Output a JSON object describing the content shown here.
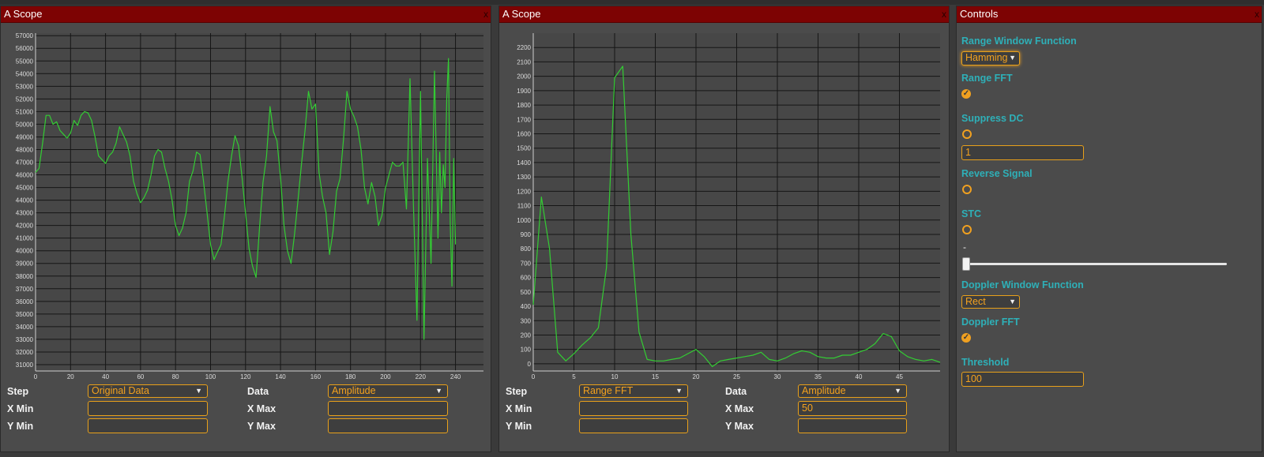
{
  "scope1": {
    "title": "A Scope",
    "close": "x",
    "form": {
      "step_label": "Step",
      "step_value": "Original Data",
      "data_label": "Data",
      "data_value": "Amplitude",
      "xmin_label": "X Min",
      "xmin_value": "",
      "xmax_label": "X Max",
      "xmax_value": "",
      "ymin_label": "Y Min",
      "ymin_value": "",
      "ymax_label": "Y Max",
      "ymax_value": ""
    }
  },
  "scope2": {
    "title": "A Scope",
    "close": "x",
    "form": {
      "step_label": "Step",
      "step_value": "Range FFT",
      "data_label": "Data",
      "data_value": "Amplitude",
      "xmin_label": "X Min",
      "xmin_value": "",
      "xmax_label": "X Max",
      "xmax_value": "50",
      "ymin_label": "Y Min",
      "ymin_value": "",
      "ymax_label": "Y Max",
      "ymax_value": ""
    }
  },
  "controls": {
    "title": "Controls",
    "close": "x",
    "range_window_label": "Range Window Function",
    "range_window_value": "Hamming",
    "range_fft_label": "Range FFT",
    "range_fft_checked": true,
    "suppress_dc_label": "Suppress DC",
    "suppress_dc_checked": false,
    "suppress_dc_value": "1",
    "reverse_signal_label": "Reverse Signal",
    "reverse_signal_checked": false,
    "stc_label": "STC",
    "stc_checked": false,
    "stc_slider_label": "-",
    "stc_slider_level": 0,
    "doppler_window_label": "Doppler Window Function",
    "doppler_window_value": "Rect",
    "doppler_fft_label": "Doppler FFT",
    "doppler_fft_checked": true,
    "threshold_label": "Threshold",
    "threshold_value": "100"
  },
  "colors": {
    "accent": "#f0a020",
    "trace": "#33cc33",
    "title_bar": "#7d0303",
    "control_label": "#2eb0b8"
  },
  "chart_data": [
    {
      "type": "line",
      "xlim": [
        0,
        256
      ],
      "ylim": [
        30500,
        57200
      ],
      "xticks": [
        0,
        20,
        40,
        60,
        80,
        100,
        120,
        140,
        160,
        180,
        200,
        220,
        240
      ],
      "yticks": [
        31000,
        32000,
        33000,
        34000,
        35000,
        36000,
        37000,
        38000,
        39000,
        40000,
        41000,
        42000,
        43000,
        44000,
        45000,
        46000,
        47000,
        48000,
        49000,
        50000,
        51000,
        52000,
        53000,
        54000,
        55000,
        56000,
        57000
      ],
      "grid": true,
      "x": [
        0,
        2,
        4,
        6,
        8,
        10,
        12,
        14,
        16,
        18,
        20,
        22,
        24,
        26,
        28,
        30,
        32,
        34,
        36,
        38,
        40,
        42,
        44,
        46,
        48,
        50,
        52,
        54,
        56,
        58,
        60,
        62,
        64,
        66,
        68,
        70,
        72,
        74,
        76,
        78,
        80,
        82,
        84,
        86,
        88,
        90,
        92,
        94,
        96,
        98,
        100,
        102,
        104,
        106,
        108,
        110,
        112,
        114,
        116,
        118,
        120,
        122,
        124,
        126,
        128,
        130,
        132,
        134,
        136,
        138,
        140,
        142,
        144,
        146,
        148,
        150,
        152,
        154,
        156,
        158,
        160,
        162,
        164,
        166,
        168,
        170,
        172,
        174,
        176,
        178,
        180,
        182,
        184,
        186,
        188,
        190,
        192,
        194,
        196,
        198,
        200,
        202,
        204,
        206,
        208,
        210,
        212,
        214,
        216,
        218,
        220,
        222,
        224,
        226,
        228,
        230,
        231,
        232,
        233,
        234,
        235,
        236,
        237,
        238,
        239,
        240,
        241,
        242,
        243,
        244,
        245,
        246,
        247,
        248,
        249,
        250,
        251,
        252,
        253,
        254,
        255
      ],
      "y": [
        46200,
        46500,
        48500,
        50700,
        50700,
        50000,
        50200,
        49500,
        49200,
        48900,
        49300,
        50300,
        49900,
        50700,
        51000,
        50900,
        50300,
        49000,
        47500,
        47200,
        46900,
        47500,
        47800,
        48500,
        49800,
        49200,
        48600,
        47500,
        45500,
        44500,
        43800,
        44200,
        44800,
        46000,
        47500,
        48000,
        47800,
        46500,
        45500,
        44000,
        42000,
        41200,
        41800,
        43000,
        45500,
        46300,
        47800,
        47600,
        45500,
        43000,
        40500,
        39300,
        39900,
        40500,
        42800,
        45500,
        47500,
        49100,
        48300,
        45800,
        43000,
        40200,
        38800,
        37900,
        41800,
        45400,
        47500,
        51400,
        49400,
        48700,
        45800,
        42000,
        40000,
        39000,
        41300,
        44000,
        46900,
        49500,
        52600,
        51200,
        51600,
        46200,
        44300,
        43000,
        39700,
        41500,
        44700,
        45700,
        48800,
        52600,
        51200,
        50600,
        49800,
        48000,
        45000,
        43700,
        45400,
        44300,
        42000,
        42800,
        45000,
        46000,
        47000,
        46700,
        46700,
        47000,
        43300,
        53600,
        43500,
        34500,
        52600,
        33000,
        47300,
        39000,
        54200,
        41000,
        47800,
        43000,
        46800,
        45000,
        52000,
        55200,
        42200,
        37200,
        47300,
        40500
      ],
      "note_x_values_are_offsets": false
    },
    {
      "type": "line",
      "xlim": [
        0,
        50
      ],
      "ylim": [
        -50,
        2300
      ],
      "xticks": [
        0,
        5,
        10,
        15,
        20,
        25,
        30,
        35,
        40,
        45
      ],
      "yticks": [
        0,
        100,
        200,
        300,
        400,
        500,
        600,
        700,
        800,
        900,
        1000,
        1100,
        1200,
        1300,
        1400,
        1500,
        1600,
        1700,
        1800,
        1900,
        2000,
        2100,
        2200
      ],
      "grid": true,
      "x": [
        0,
        1,
        2,
        3,
        4,
        5,
        6,
        7,
        8,
        9,
        10,
        11,
        12,
        13,
        14,
        15,
        16,
        17,
        18,
        19,
        20,
        21,
        22,
        23,
        24,
        25,
        26,
        27,
        28,
        29,
        30,
        31,
        32,
        33,
        34,
        35,
        36,
        37,
        38,
        39,
        40,
        41,
        42,
        43,
        44,
        45,
        46,
        47,
        48,
        49,
        50
      ],
      "y": [
        410,
        1160,
        800,
        80,
        20,
        70,
        130,
        180,
        250,
        670,
        1990,
        2070,
        900,
        220,
        30,
        20,
        20,
        30,
        40,
        70,
        100,
        50,
        -20,
        20,
        30,
        40,
        50,
        60,
        80,
        30,
        20,
        40,
        70,
        90,
        80,
        50,
        40,
        40,
        60,
        60,
        80,
        100,
        140,
        210,
        190,
        90,
        50,
        30,
        20,
        30,
        10
      ]
    }
  ]
}
